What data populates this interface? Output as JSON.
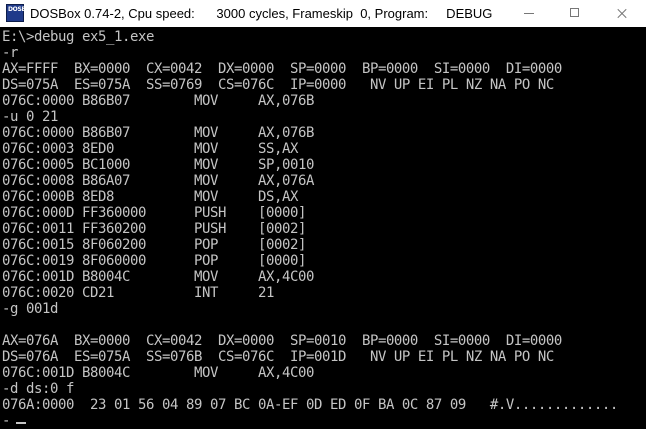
{
  "window": {
    "icon_label": "DOSBOX",
    "title": "DOSBox 0.74-2, Cpu speed:      3000 cycles, Frameskip  0, Program:     DEBUG"
  },
  "console": {
    "lines": [
      "E:\\>debug ex5_1.exe",
      "-r",
      "AX=FFFF  BX=0000  CX=0042  DX=0000  SP=0000  BP=0000  SI=0000  DI=0000",
      "DS=075A  ES=075A  SS=0769  CS=076C  IP=0000   NV UP EI PL NZ NA PO NC",
      "076C:0000 B86B07        MOV     AX,076B",
      "-u 0 21",
      "076C:0000 B86B07        MOV     AX,076B",
      "076C:0003 8ED0          MOV     SS,AX",
      "076C:0005 BC1000        MOV     SP,0010",
      "076C:0008 B86A07        MOV     AX,076A",
      "076C:000B 8ED8          MOV     DS,AX",
      "076C:000D FF360000      PUSH    [0000]",
      "076C:0011 FF360200      PUSH    [0002]",
      "076C:0015 8F060200      POP     [0002]",
      "076C:0019 8F060000      POP     [0000]",
      "076C:001D B8004C        MOV     AX,4C00",
      "076C:0020 CD21          INT     21",
      "-g 001d",
      "",
      "AX=076A  BX=0000  CX=0042  DX=0000  SP=0010  BP=0000  SI=0000  DI=0000",
      "DS=076A  ES=075A  SS=076B  CS=076C  IP=001D   NV UP EI PL NZ NA PO NC",
      "076C:001D B8004C        MOV     AX,4C00",
      "-d ds:0 f",
      "076A:0000  23 01 56 04 89 07 BC 0A-EF 0D ED 0F BA 0C 87 09   #.V.............",
      "-"
    ]
  }
}
